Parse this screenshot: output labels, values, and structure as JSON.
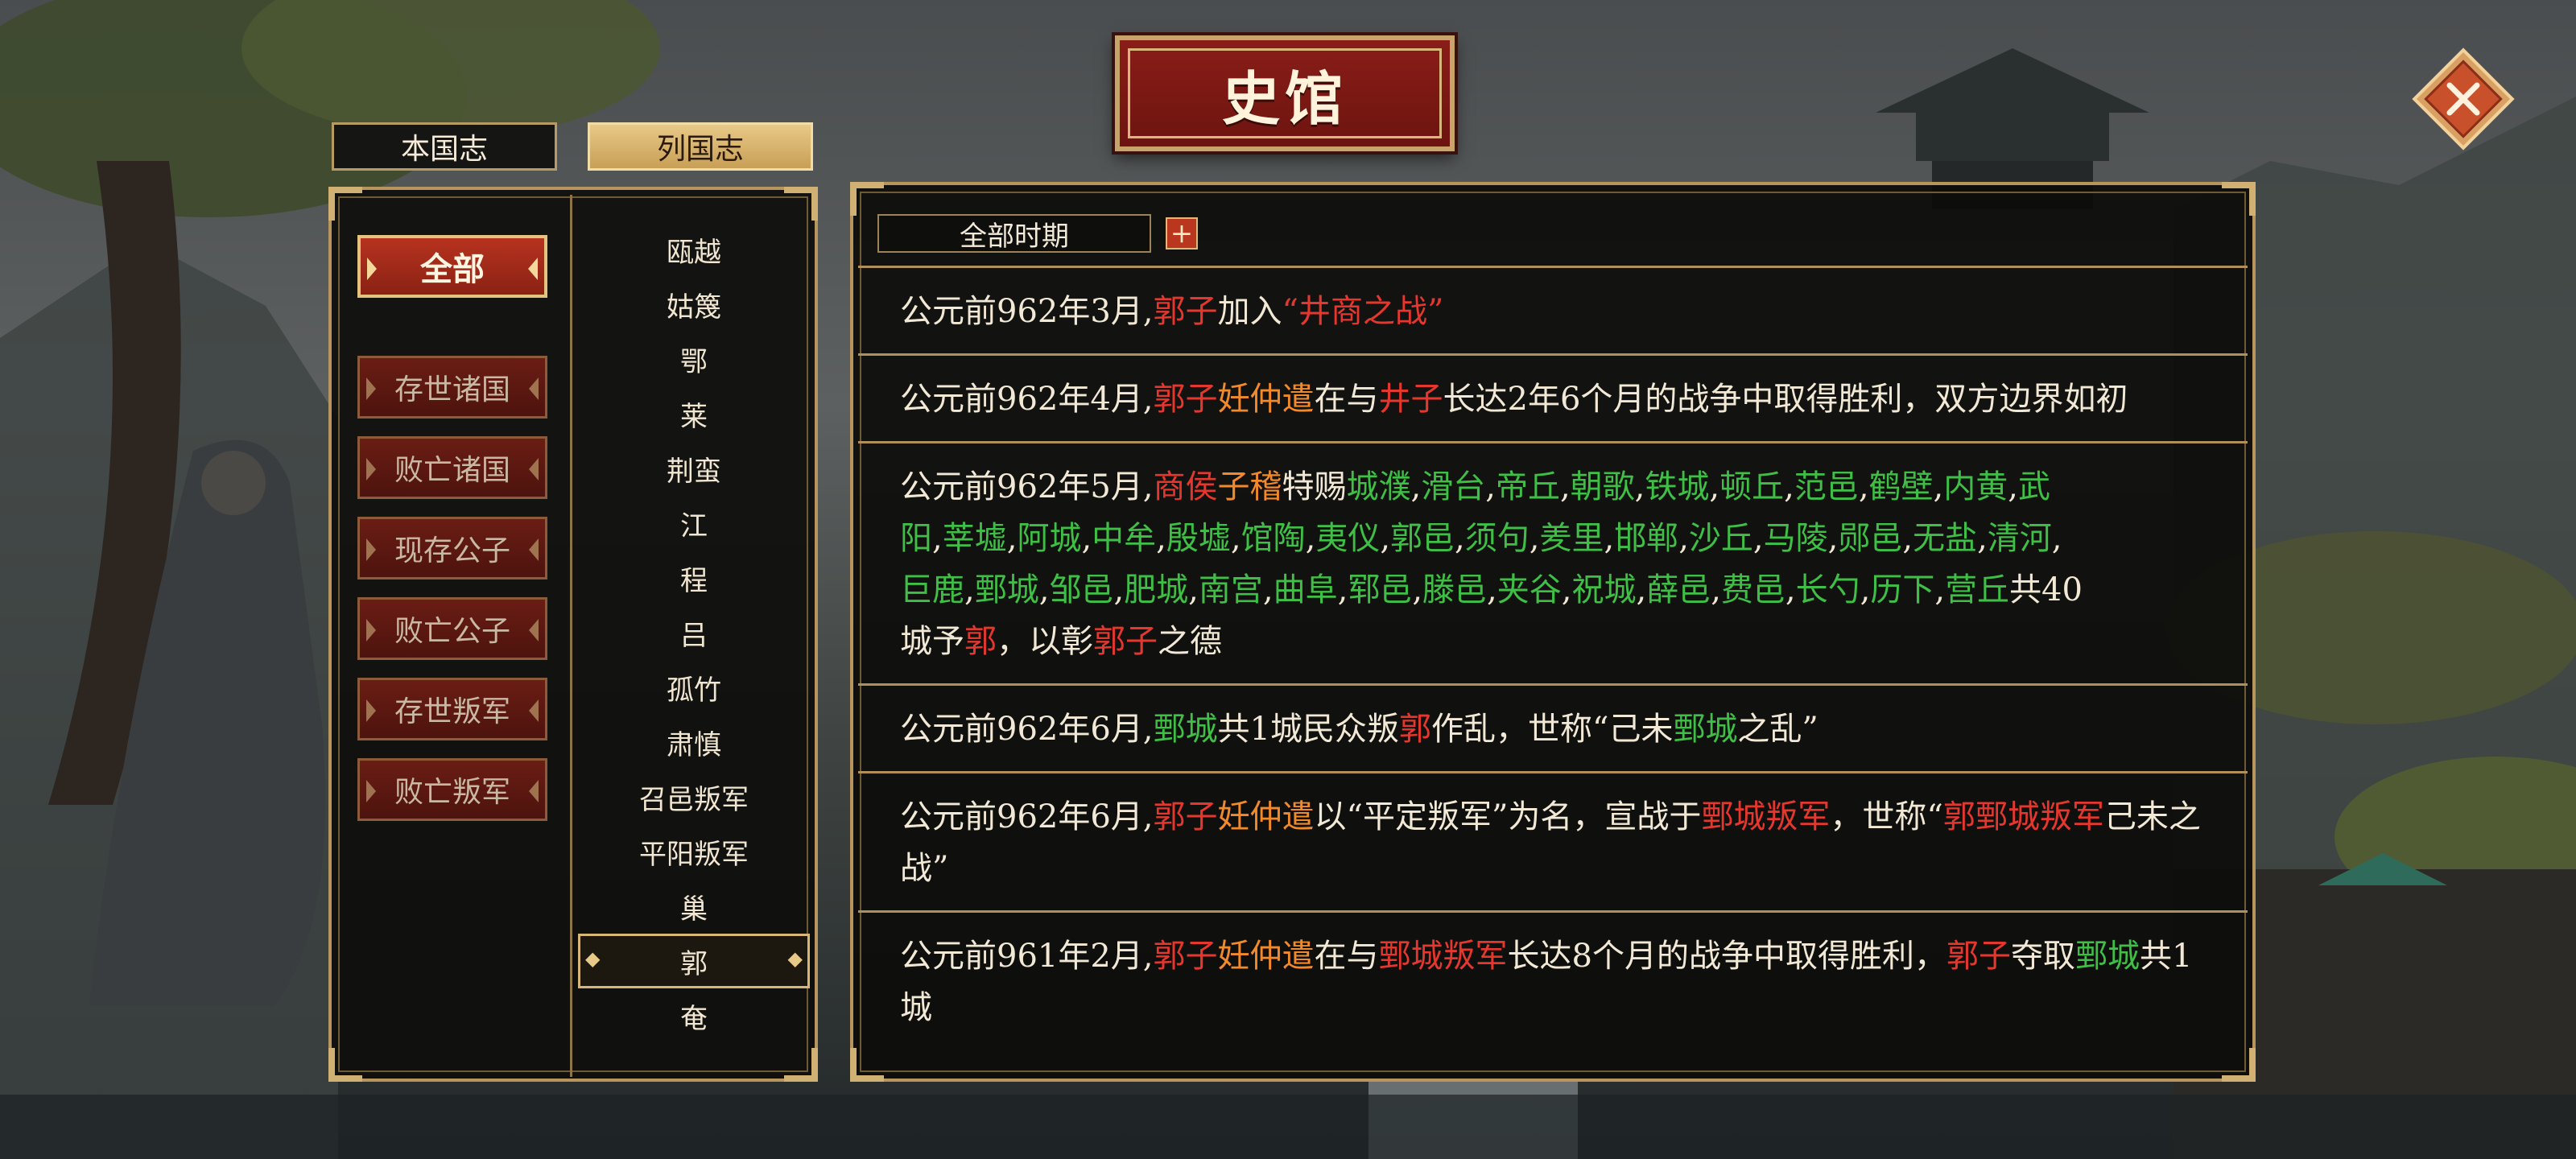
{
  "title": "史馆",
  "top_tabs": [
    {
      "label": "本国志",
      "active": false
    },
    {
      "label": "列国志",
      "active": true
    }
  ],
  "categories": [
    {
      "label": "全部",
      "active": true
    },
    {
      "label": "存世诸国"
    },
    {
      "label": "败亡诸国"
    },
    {
      "label": "现存公子"
    },
    {
      "label": "败亡公子"
    },
    {
      "label": "存世叛军"
    },
    {
      "label": "败亡叛军"
    }
  ],
  "states": [
    "瓯越",
    "姑篾",
    "鄂",
    "莱",
    "荆蛮",
    "江",
    "程",
    "吕",
    "孤竹",
    "肃慎",
    "召邑叛军",
    "平阳叛军",
    "巢",
    "郭",
    "奄"
  ],
  "selected_state": "郭",
  "period": {
    "label": "全部时期",
    "plus": "+"
  },
  "events": [
    {
      "text": "公元前962年3月,郭子加入“井商之战”"
    },
    {
      "text": "公元前962年4月,郭子妊仲遣在与井子长达2年6个月的战争中取得胜利，双方边界如初"
    },
    {
      "text": "公元前962年5月,商侯子稽特赐城濮,滑台,帝丘,朝歌,铁城,顿丘,范邑,鹤壁,内黄,武阳,莘墟,阿城,中牟,殷墟,馆陶,夷仪,郭邑,须句,羑里,邯郸,沙丘,马陵,郧邑,无盐,清河,巨鹿,鄄城,邹邑,肥城,南宫,曲阜,郓邑,滕邑,夹谷,祝城,薛邑,费邑,长勺,历下,营丘共40城予郭，以彰郭子之德"
    },
    {
      "text": "公元前962年6月,鄄城共1城民众叛郭作乱，世称“己未鄄城之乱”"
    },
    {
      "text": "公元前962年6月,郭子妊仲遣以“平定叛军”为名，宣战于鄄城叛军，世称“郭鄄城叛军己未之战”"
    },
    {
      "text": "公元前961年2月,郭子妊仲遣在与鄄城叛军长达8个月的战争中取得胜利，郭子夺取鄄城共1城"
    }
  ],
  "colors": {
    "person_red": "#e5372d",
    "name_orange": "#f28a2b",
    "city_green": "#3fbf45",
    "gold": "#b7955c"
  }
}
